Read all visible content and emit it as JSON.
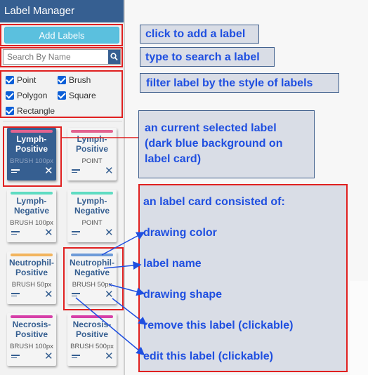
{
  "panel": {
    "title": "Label Manager",
    "add_label": "Add Labels",
    "search_placeholder": "Search By Name",
    "filters": [
      "Point",
      "Brush",
      "Polygon",
      "Square",
      "Rectangle"
    ]
  },
  "cards": [
    {
      "name": "Lymph-Positive",
      "shape": "BRUSH 100px",
      "color": "#e2638f",
      "selected": true
    },
    {
      "name": "Lymph-Positive",
      "shape": "POINT",
      "color": "#e2638f",
      "selected": false
    },
    {
      "name": "Lymph-Negative",
      "shape": "BRUSH 100px",
      "color": "#5fdcc2",
      "selected": false
    },
    {
      "name": "Lymph-Negative",
      "shape": "POINT",
      "color": "#5fdcc2",
      "selected": false
    },
    {
      "name": "Neutrophil-Positive",
      "shape": "BRUSH 50px",
      "color": "#f2b45e",
      "selected": false
    },
    {
      "name": "Neutrophil-Negative",
      "shape": "BRUSH 50px",
      "color": "#6e9bd8",
      "selected": false
    },
    {
      "name": "Necrosis-Positive",
      "shape": "BRUSH 100px",
      "color": "#d63fa8",
      "selected": false
    },
    {
      "name": "Necrosis-Positive",
      "shape": "BRUSH 500px",
      "color": "#d63fa8",
      "selected": false
    }
  ],
  "callouts": {
    "add": "click to add a label",
    "search": "type to search a label",
    "filter": "filter label by the style of labels",
    "selected": "an current selected label (dark blue background on label card)",
    "card_intro": "an label card consisted of:",
    "drawing_color": "drawing color",
    "label_name": "label name",
    "drawing_shape": "drawing shape",
    "remove": "remove this label (clickable)",
    "edit": "edit this label (clickable)"
  }
}
